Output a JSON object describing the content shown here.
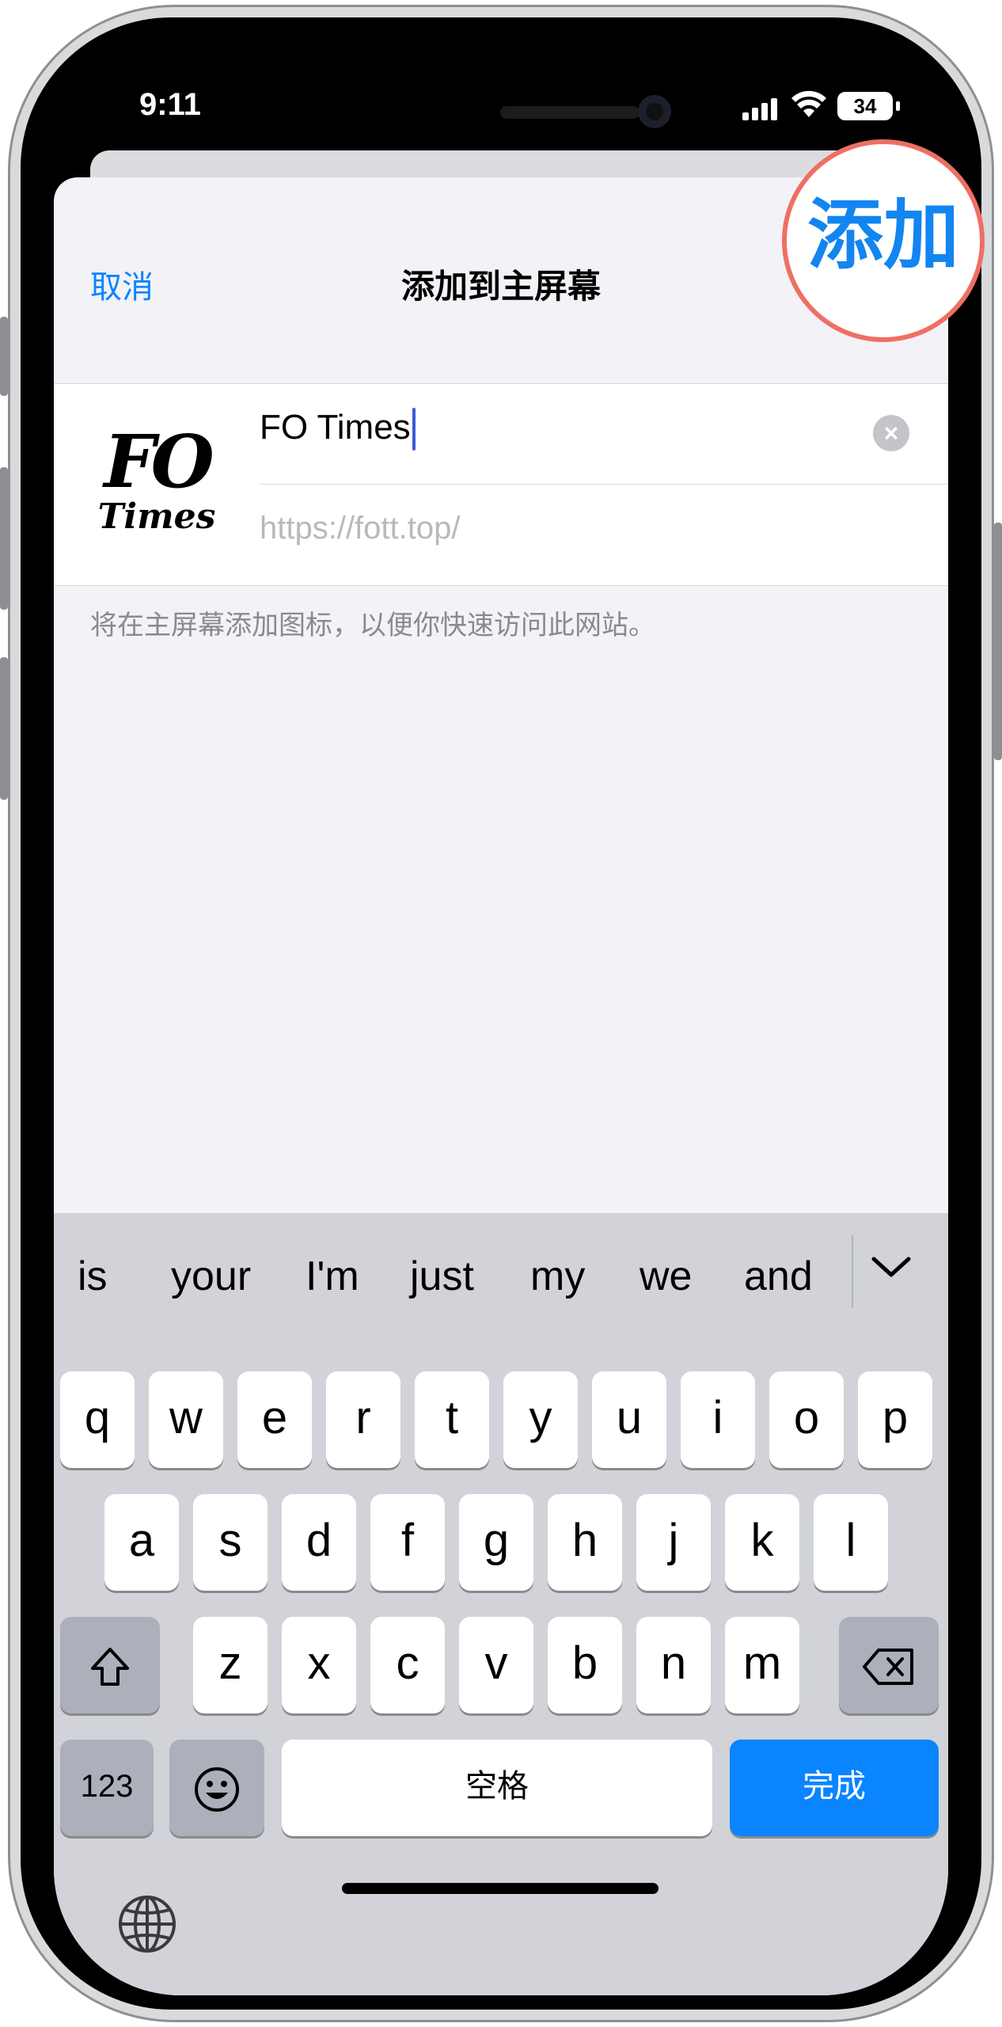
{
  "status_bar": {
    "time": "9:11",
    "battery": "34"
  },
  "sheet": {
    "cancel_label": "取消",
    "title": "添加到主屏幕",
    "add_label": "添加",
    "app_icon": {
      "line1": "FO",
      "line2": "Times"
    },
    "name_value": "FO Times",
    "url_value": "https://fott.top/",
    "footer_note": "将在主屏幕添加图标，以便你快速访问此网站。"
  },
  "keyboard": {
    "suggestions": [
      "is",
      "your",
      "I'm",
      "just",
      "my",
      "we",
      "and"
    ],
    "row1": [
      "q",
      "w",
      "e",
      "r",
      "t",
      "y",
      "u",
      "i",
      "o",
      "p"
    ],
    "row2": [
      "a",
      "s",
      "d",
      "f",
      "g",
      "h",
      "j",
      "k",
      "l"
    ],
    "row3": [
      "z",
      "x",
      "c",
      "v",
      "b",
      "n",
      "m"
    ],
    "num_label": "123",
    "space_label": "空格",
    "done_label": "完成"
  },
  "colors": {
    "accent": "#0a84ff",
    "highlight_ring": "#ee6f64",
    "keyboard_bg": "#d1d3d9"
  },
  "icons": [
    "shift-icon",
    "backspace-icon",
    "emoji-icon",
    "globe-icon",
    "chevron-down-icon",
    "clear-icon"
  ]
}
